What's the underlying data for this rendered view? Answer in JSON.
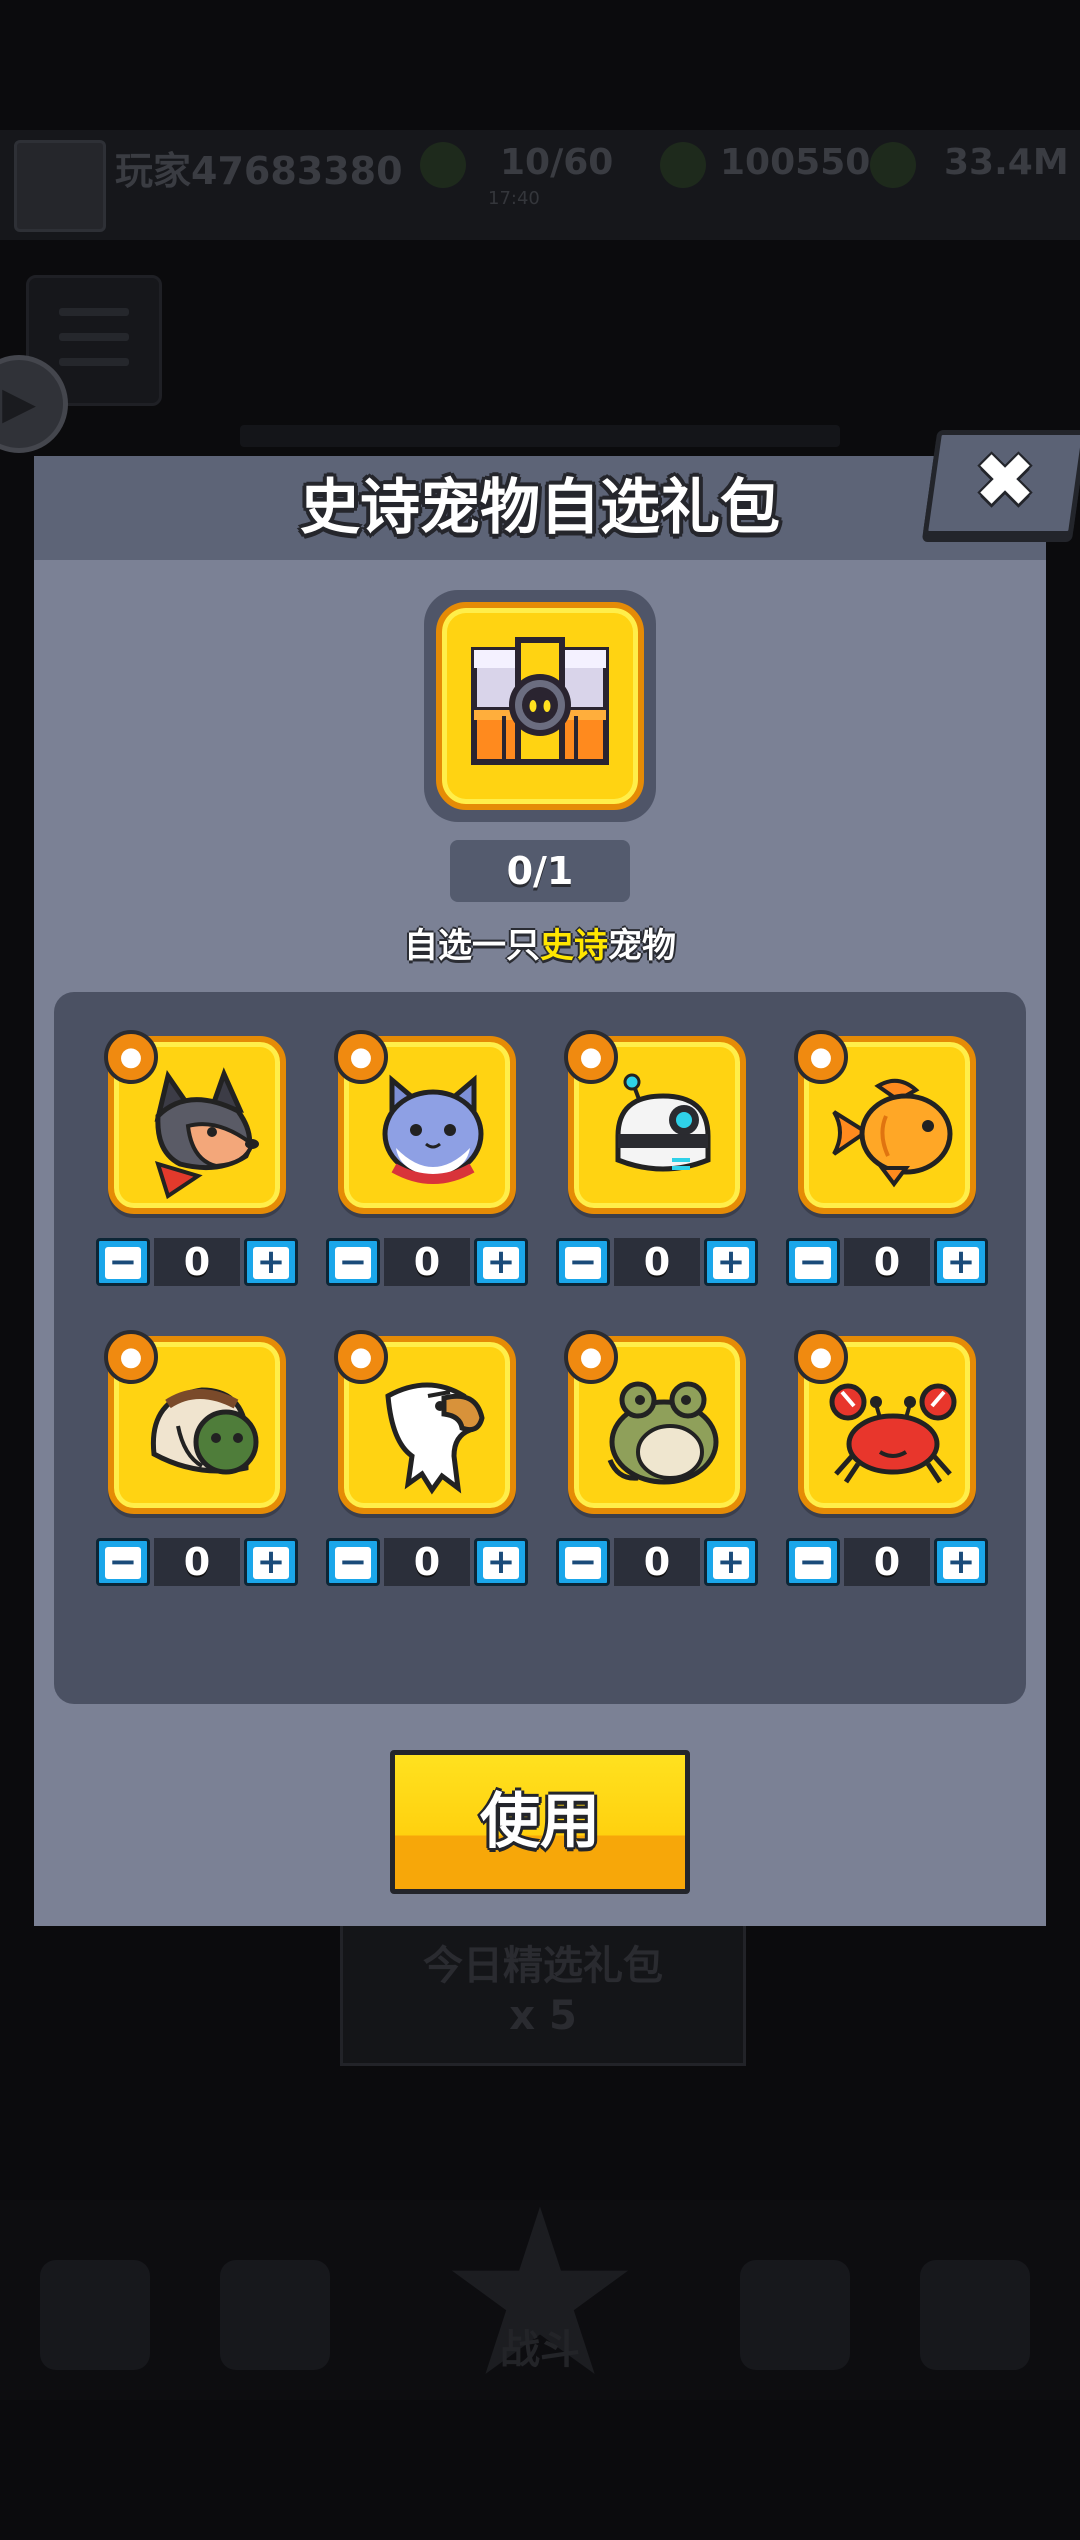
{
  "background": {
    "player_name": "玩家47683380",
    "stamina": "10/60",
    "stamina_timer": "17:40",
    "gold": "100550",
    "power": "33.4M",
    "banner_text": "今日精选礼包",
    "banner_reward": "x 5",
    "nav_center_label": "战斗"
  },
  "dialog": {
    "title": "史诗宠物自选礼包",
    "close_icon": "close-x-icon",
    "chest_icon": "treasure-chest-icon",
    "counter": "0/1",
    "subtitle_before": "自选一只",
    "subtitle_highlight": "史诗",
    "subtitle_after": "宠物",
    "use_button": "使用",
    "minus_label": "−",
    "plus_label": "+"
  },
  "pets": [
    {
      "name": "dog",
      "badge": "dog-head-icon",
      "count": "0"
    },
    {
      "name": "cat",
      "badge": "coin-stack-icon",
      "count": "0"
    },
    {
      "name": "robot",
      "badge": "dog-head-icon",
      "count": "0"
    },
    {
      "name": "goldfish",
      "badge": "turtle-shell-icon",
      "count": "0"
    },
    {
      "name": "turtle",
      "badge": "turtle-shell-icon",
      "count": "0"
    },
    {
      "name": "eagle",
      "badge": "eagle-head-icon",
      "count": "0"
    },
    {
      "name": "frog",
      "badge": "coin-stack-icon",
      "count": "0"
    },
    {
      "name": "crab",
      "badge": "eagle-head-icon",
      "count": "0"
    }
  ],
  "colors": {
    "card_fill": "#ffd312",
    "card_border": "#e58b06",
    "stepper_blue": "#1aa6ea",
    "highlight_yellow": "#ffe600",
    "dialog_body": "#7b8195",
    "dialog_header": "#5d6477"
  }
}
